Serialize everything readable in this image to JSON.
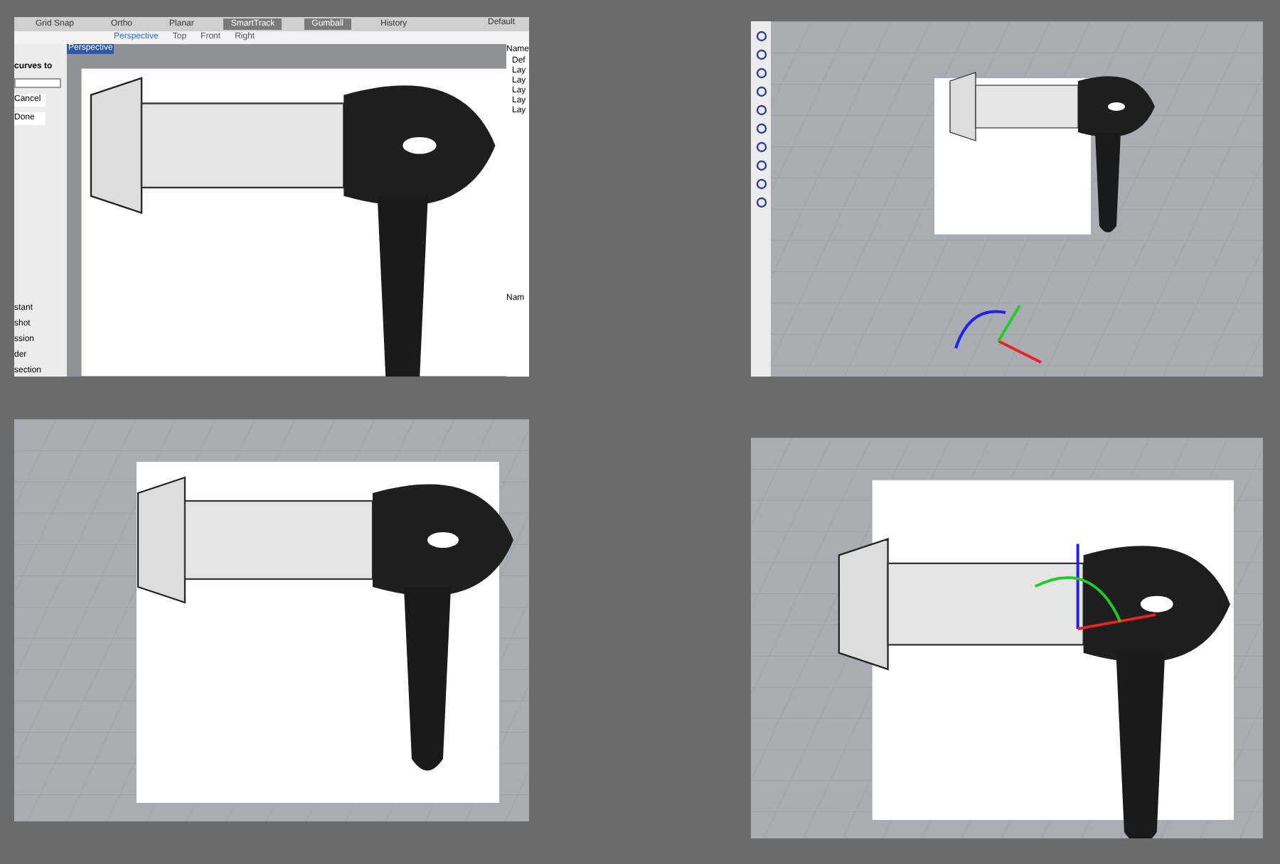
{
  "panels": [
    {
      "kind": "app",
      "toolbar": [
        {
          "label": "Grid Snap",
          "on": false
        },
        {
          "label": "Ortho",
          "on": false
        },
        {
          "label": "Planar",
          "on": false
        },
        {
          "label": "SmartTrack",
          "on": true
        },
        {
          "label": "Gumball",
          "on": true
        },
        {
          "label": "History",
          "on": false
        }
      ],
      "layer_default": "Default",
      "tabs": [
        {
          "label": "Perspective",
          "selected": true
        },
        {
          "label": "Top",
          "selected": false
        },
        {
          "label": "Front",
          "selected": false
        },
        {
          "label": "Right",
          "selected": false
        }
      ],
      "viewport_label": "Perspective",
      "command": {
        "prompt": "curves to",
        "buttons": [
          "Cancel",
          "Done"
        ],
        "list": [
          "stant",
          "shot",
          "ssion",
          "der",
          "section"
        ]
      },
      "layers": {
        "header": "Name",
        "items": [
          "Def",
          "Lay",
          "Lay",
          "Lay",
          "Lay",
          "Lay"
        ],
        "footer": "Nam"
      }
    },
    {
      "kind": "viewport3d"
    },
    {
      "kind": "front"
    },
    {
      "kind": "gumball"
    }
  ]
}
